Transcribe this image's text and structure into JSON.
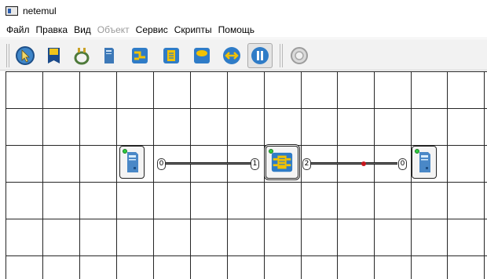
{
  "window": {
    "title": "netemul"
  },
  "menu": [
    {
      "label": "Файл",
      "enabled": true
    },
    {
      "label": "Правка",
      "enabled": true
    },
    {
      "label": "Вид",
      "enabled": true
    },
    {
      "label": "Объект",
      "enabled": false
    },
    {
      "label": "Сервис",
      "enabled": true
    },
    {
      "label": "Скрипты",
      "enabled": true
    },
    {
      "label": "Помощь",
      "enabled": true
    }
  ],
  "toolbar": {
    "tools": [
      {
        "name": "select-tool-icon",
        "checked": false
      },
      {
        "name": "text-note-icon",
        "checked": false
      },
      {
        "name": "cable-icon",
        "checked": false
      },
      {
        "name": "computer-icon",
        "checked": false
      },
      {
        "name": "hub-icon",
        "checked": false
      },
      {
        "name": "switch-icon",
        "checked": false
      },
      {
        "name": "router-icon",
        "checked": false
      },
      {
        "name": "send-icon",
        "checked": false
      },
      {
        "name": "pause-icon",
        "checked": true
      },
      {
        "name": "settings-icon",
        "checked": false
      }
    ]
  },
  "scene": {
    "devices": [
      {
        "type": "computer",
        "status": "on",
        "selected": false
      },
      {
        "type": "switch",
        "status": "on",
        "selected": true
      },
      {
        "type": "computer",
        "status": "on",
        "selected": false
      }
    ],
    "ports": [
      "0",
      "1",
      "2",
      "0"
    ],
    "cables": [
      {
        "from": "computer-1 port 0",
        "to": "switch port 1",
        "packet": false
      },
      {
        "from": "switch port 2",
        "to": "computer-2 port 0",
        "packet": true
      }
    ],
    "colors": {
      "led": "#2ecc40",
      "packet": "#c8161d",
      "cable": "#1e1e1e"
    }
  }
}
